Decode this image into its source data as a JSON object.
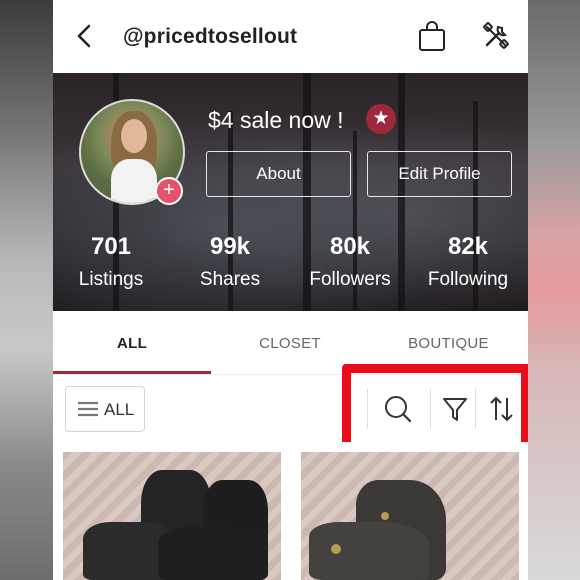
{
  "header": {
    "username": "@pricedtosellout",
    "icons": [
      "back-icon",
      "shopping-bag-icon",
      "tools-icon"
    ]
  },
  "profile": {
    "headline": "$4 sale now !",
    "badge_icon": "star-icon",
    "avatar_add_label": "+",
    "buttons": {
      "about": "About",
      "edit_profile": "Edit Profile"
    },
    "stats": [
      {
        "value": "701",
        "label": "Listings"
      },
      {
        "value": "99k",
        "label": "Shares"
      },
      {
        "value": "80k",
        "label": "Followers"
      },
      {
        "value": "82k",
        "label": "Following"
      }
    ]
  },
  "tabs": [
    {
      "label": "ALL",
      "active": true
    },
    {
      "label": "CLOSET",
      "active": false
    },
    {
      "label": "BOUTIQUE",
      "active": false
    }
  ],
  "filters": {
    "all_button_label": "ALL",
    "tool_icons": [
      "search-icon",
      "filter-icon",
      "sort-icon"
    ]
  },
  "colors": {
    "accent": "#a0283c",
    "avatar_add": "#e2536c",
    "highlight": "#ea0c1a"
  },
  "listings": [
    {
      "name": "black-ankle-boots"
    },
    {
      "name": "grey-suede-lace-up-booties"
    }
  ]
}
